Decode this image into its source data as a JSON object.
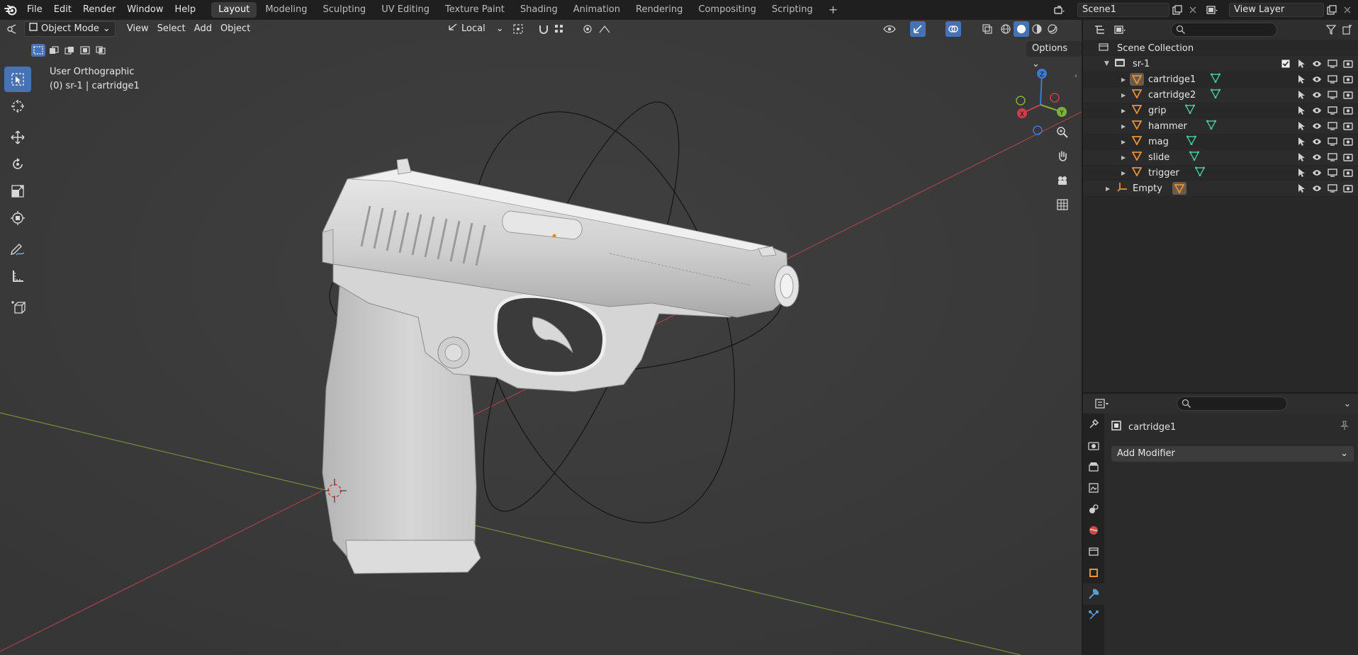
{
  "topbar": {
    "menus": [
      "File",
      "Edit",
      "Render",
      "Window",
      "Help"
    ],
    "workspaces": [
      "Layout",
      "Modeling",
      "Sculpting",
      "UV Editing",
      "Texture Paint",
      "Shading",
      "Animation",
      "Rendering",
      "Compositing",
      "Scripting"
    ],
    "active_workspace": "Layout",
    "add_workspace": "+",
    "scene_name": "Scene1",
    "view_layer": "View Layer"
  },
  "viewport_header": {
    "mode": "Object Mode",
    "menus": [
      "View",
      "Select",
      "Add",
      "Object"
    ],
    "transform_orientation": "Local",
    "options_label": "Options"
  },
  "viewport": {
    "view_name": "User Orthographic",
    "active_info": "(0) sr-1 | cartridge1",
    "gizmo_axes": {
      "z": "Z",
      "y": "Y",
      "x": "X"
    },
    "colors": {
      "bg": "#3a3a3a",
      "x_axis": "#c0404a",
      "y_axis": "#7a9a3a",
      "accent": "#4772b3"
    }
  },
  "tools": [
    "select-box-icon",
    "cursor-icon",
    "move-icon",
    "rotate-icon",
    "scale-icon",
    "transform-icon",
    "annotate-icon",
    "measure-icon",
    "add-cube-icon"
  ],
  "outliner": {
    "root": "Scene Collection",
    "collection": "sr-1",
    "objects": [
      "cartridge1",
      "cartridge2",
      "grip",
      "hammer",
      "mag",
      "slide",
      "trigger"
    ],
    "empty": "Empty"
  },
  "properties": {
    "object_name": "cartridge1",
    "add_modifier": "Add Modifier"
  }
}
